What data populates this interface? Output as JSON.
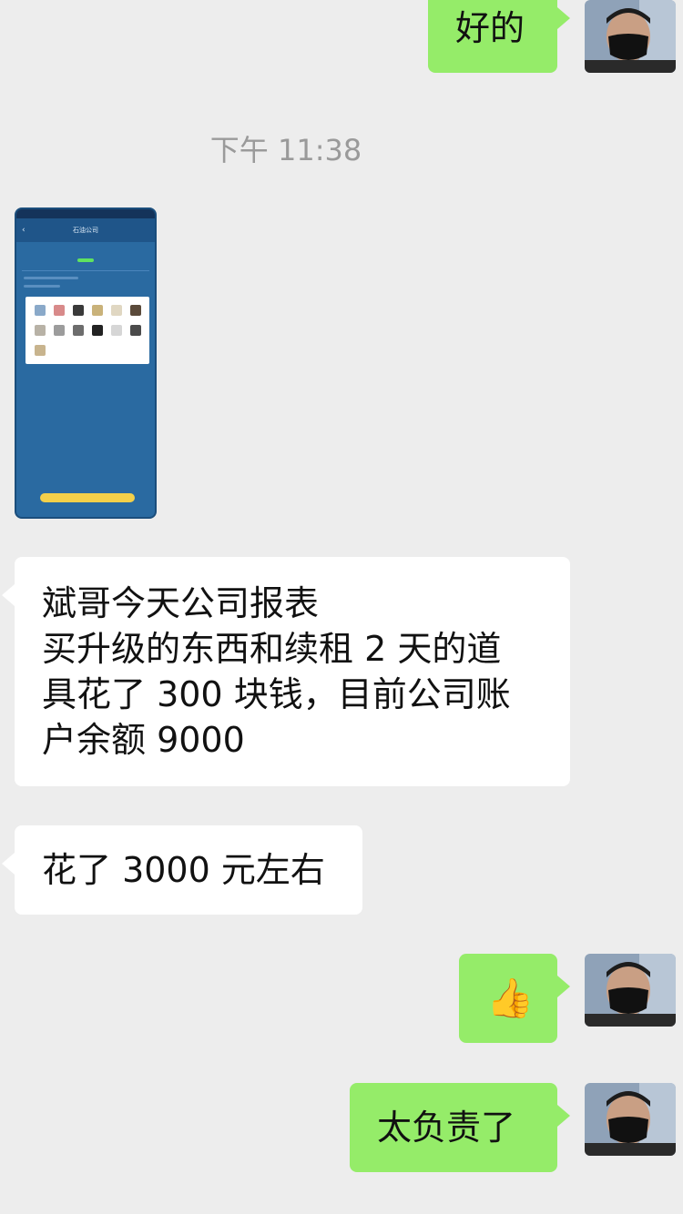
{
  "messages": [
    {
      "side": "out",
      "text": "好的"
    },
    {
      "type": "timestamp",
      "text": "下午 11:38"
    },
    {
      "side": "in",
      "type": "image",
      "alt": "phone-screenshot",
      "caption": "石油公司"
    },
    {
      "side": "in",
      "lines": [
        "斌哥今天公司报表",
        "买升级的东西和续租 2 天的道",
        "具花了 300 块钱，目前公司账",
        "户余额 9000"
      ]
    },
    {
      "side": "in",
      "text": "花了 3000 元左右"
    },
    {
      "side": "out",
      "emoji": "👍",
      "icon": "thumbs-up-icon"
    },
    {
      "side": "out",
      "text": "太负责了"
    }
  ],
  "colors": {
    "background": "#ededed",
    "outgoing_bubble": "#95ec69",
    "incoming_bubble": "#ffffff",
    "timestamp": "#9a9a9a"
  }
}
